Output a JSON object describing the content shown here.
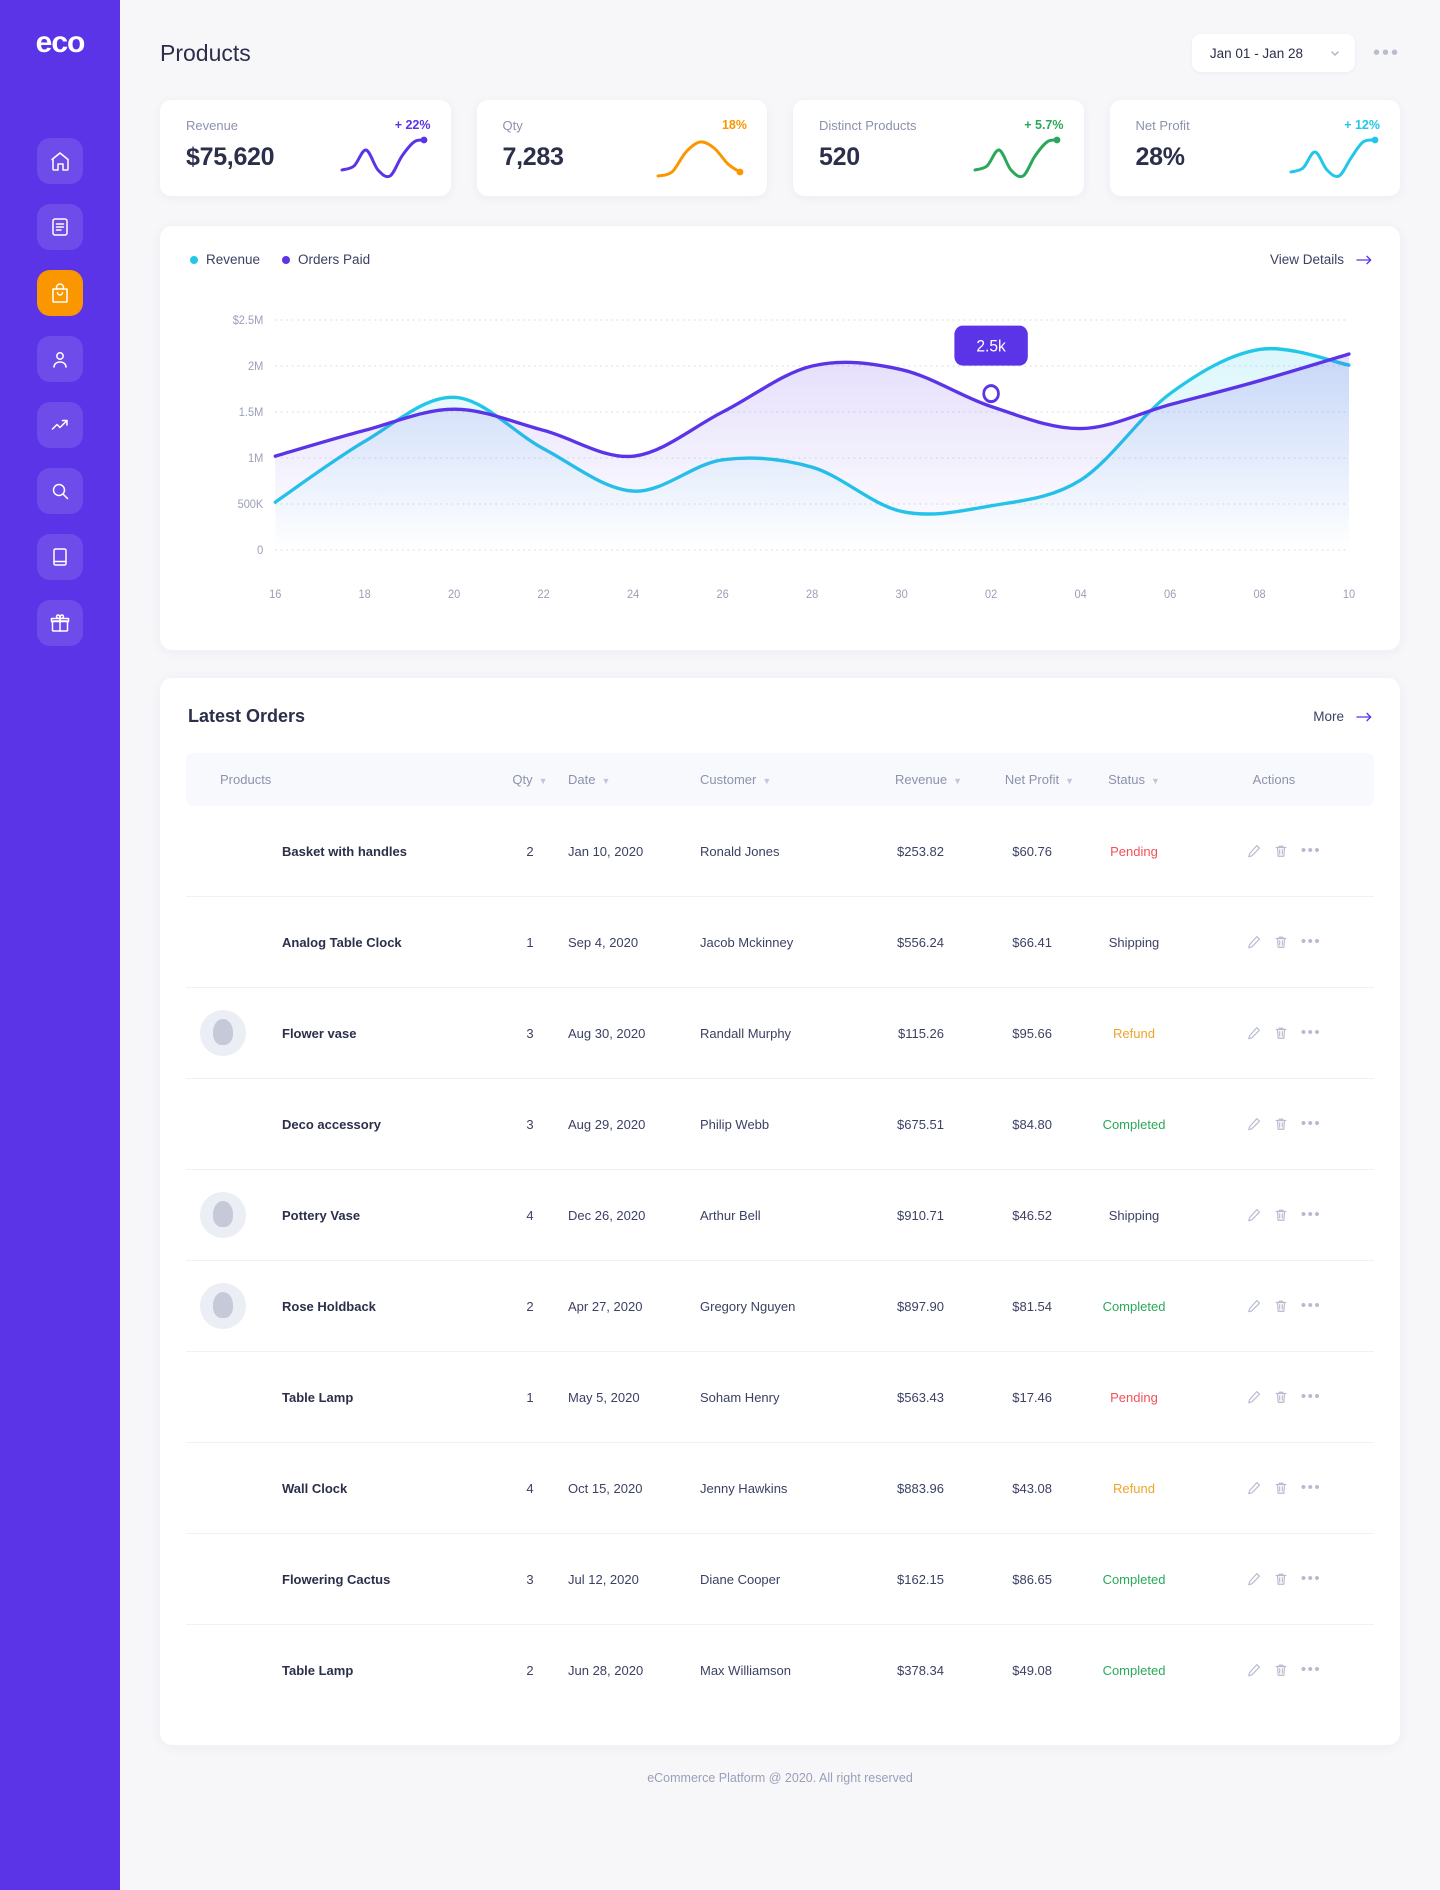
{
  "brand": {
    "logo": "eco",
    "accent": "#5b34e8",
    "active": "#fa9600"
  },
  "sidebar": {
    "items": [
      {
        "icon": "home-icon",
        "name": "home",
        "active": false
      },
      {
        "icon": "document-icon",
        "name": "orders",
        "active": false
      },
      {
        "icon": "shopping-bag-icon",
        "name": "products",
        "active": true
      },
      {
        "icon": "user-icon",
        "name": "customers",
        "active": false
      },
      {
        "icon": "trending-up-icon",
        "name": "analytics",
        "active": false
      },
      {
        "icon": "search-icon",
        "name": "search",
        "active": false
      },
      {
        "icon": "book-icon",
        "name": "catalog",
        "active": false
      },
      {
        "icon": "gift-icon",
        "name": "promotions",
        "active": false
      }
    ]
  },
  "header": {
    "title": "Products",
    "date_range": "Jan 01 -  Jan 28",
    "more_label": "•••"
  },
  "stats": [
    {
      "label": "Revenue",
      "value": "$75,620",
      "delta": "+ 22%",
      "delta_color": "#5b34e8",
      "line_color": "#5b34e8"
    },
    {
      "label": "Qty",
      "value": "7,283",
      "delta": "18%",
      "delta_color": "#fa9600",
      "line_color": "#fa9600"
    },
    {
      "label": "Distinct Products",
      "value": "520",
      "delta": "+ 5.7%",
      "delta_color": "#2aa85a",
      "line_color": "#2aa85a"
    },
    {
      "label": "Net Profit",
      "value": "28%",
      "delta": "+ 12%",
      "delta_color": "#22c7e8",
      "line_color": "#22c7e8"
    }
  ],
  "chart_card": {
    "legend": [
      {
        "label": "Revenue",
        "color": "#22c7e8"
      },
      {
        "label": "Orders Paid",
        "color": "#5b34e8"
      }
    ],
    "view_details": "View Details",
    "tooltip": "2.5k"
  },
  "chart_data": {
    "type": "line",
    "title": "",
    "xlabel": "",
    "ylabel": "",
    "ylim": [
      0,
      2500000
    ],
    "grid": true,
    "legend_position": "top-left",
    "ytick_labels": [
      "$2.5M",
      "2M",
      "1.5M",
      "1M",
      "500K",
      "0"
    ],
    "ytick_values": [
      2500000,
      2000000,
      1500000,
      1000000,
      500000,
      0
    ],
    "categories": [
      "16",
      "18",
      "20",
      "22",
      "24",
      "26",
      "28",
      "30",
      "02",
      "04",
      "06",
      "08",
      "10"
    ],
    "series": [
      {
        "name": "Revenue",
        "color": "#22c7e8",
        "values": [
          520000,
          1180000,
          1660000,
          1100000,
          640000,
          980000,
          900000,
          420000,
          480000,
          760000,
          1700000,
          2180000,
          2010000
        ]
      },
      {
        "name": "Orders Paid",
        "color": "#5b34e8",
        "values": [
          1020000,
          1300000,
          1530000,
          1300000,
          1020000,
          1500000,
          2000000,
          1960000,
          1560000,
          1320000,
          1580000,
          1840000,
          2130000
        ]
      }
    ],
    "annotations": [
      {
        "label": "2.5k",
        "series": "Orders Paid",
        "x": "02",
        "y": 1700000
      }
    ]
  },
  "orders": {
    "title": "Latest Orders",
    "more_label": "More",
    "columns": [
      {
        "label": "Products",
        "sortable": false
      },
      {
        "label": "Qty",
        "sortable": true
      },
      {
        "label": "Date",
        "sortable": true
      },
      {
        "label": "Customer",
        "sortable": true
      },
      {
        "label": "Revenue",
        "sortable": true
      },
      {
        "label": "Net Profit",
        "sortable": true
      },
      {
        "label": "Status",
        "sortable": true
      },
      {
        "label": "Actions",
        "sortable": false
      }
    ],
    "rows": [
      {
        "thumb": false,
        "product": "Basket with handles",
        "qty": "2",
        "date": "Jan 10, 2020",
        "customer": "Ronald Jones",
        "revenue": "$253.82",
        "profit": "$60.76",
        "status": "Pending",
        "status_key": "pending"
      },
      {
        "thumb": false,
        "product": "Analog Table Clock",
        "qty": "1",
        "date": "Sep 4, 2020",
        "customer": "Jacob Mckinney",
        "revenue": "$556.24",
        "profit": "$66.41",
        "status": "Shipping",
        "status_key": "shipping"
      },
      {
        "thumb": true,
        "product": "Flower vase",
        "qty": "3",
        "date": "Aug 30, 2020",
        "customer": "Randall Murphy",
        "revenue": "$115.26",
        "profit": "$95.66",
        "status": "Refund",
        "status_key": "refund"
      },
      {
        "thumb": false,
        "product": "Deco accessory",
        "qty": "3",
        "date": "Aug 29, 2020",
        "customer": "Philip Webb",
        "revenue": "$675.51",
        "profit": "$84.80",
        "status": "Completed",
        "status_key": "completed"
      },
      {
        "thumb": true,
        "product": "Pottery Vase",
        "qty": "4",
        "date": "Dec 26, 2020",
        "customer": "Arthur Bell",
        "revenue": "$910.71",
        "profit": "$46.52",
        "status": "Shipping",
        "status_key": "shipping"
      },
      {
        "thumb": true,
        "product": "Rose Holdback",
        "qty": "2",
        "date": "Apr 27, 2020",
        "customer": "Gregory Nguyen",
        "revenue": "$897.90",
        "profit": "$81.54",
        "status": "Completed",
        "status_key": "completed"
      },
      {
        "thumb": false,
        "product": "Table Lamp",
        "qty": "1",
        "date": "May 5, 2020",
        "customer": "Soham Henry",
        "revenue": "$563.43",
        "profit": "$17.46",
        "status": "Pending",
        "status_key": "pending"
      },
      {
        "thumb": false,
        "product": "Wall Clock",
        "qty": "4",
        "date": "Oct 15, 2020",
        "customer": "Jenny Hawkins",
        "revenue": "$883.96",
        "profit": "$43.08",
        "status": "Refund",
        "status_key": "refund"
      },
      {
        "thumb": false,
        "product": "Flowering Cactus",
        "qty": "3",
        "date": "Jul 12, 2020",
        "customer": "Diane Cooper",
        "revenue": "$162.15",
        "profit": "$86.65",
        "status": "Completed",
        "status_key": "completed"
      },
      {
        "thumb": false,
        "product": "Table Lamp",
        "qty": "2",
        "date": "Jun 28, 2020",
        "customer": "Max Williamson",
        "revenue": "$378.34",
        "profit": "$49.08",
        "status": "Completed",
        "status_key": "completed"
      }
    ]
  },
  "footer": {
    "text": "eCommerce Platform @ 2020. All right reserved"
  }
}
